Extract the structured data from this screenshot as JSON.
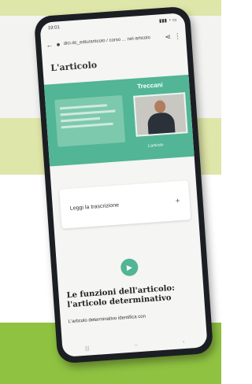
{
  "status_bar": {
    "time": "19:01",
    "indicators": "▮▮▮ ◔ ▭"
  },
  "browser": {
    "url": "dici.dc_edtu/articolo / corso ... nel-articolo",
    "share_icon": "share-icon",
    "menu_icon": "more-vert-icon"
  },
  "page": {
    "heading": "L'articolo",
    "banner": {
      "logo": "Treccani",
      "caption": "L'articolo"
    },
    "card_label": "Leggi la trascrizione",
    "card_plus": "+",
    "article_title": "Le funzioni dell'articolo: l'articolo determinativo",
    "article_subtitle": "L'articolo determinativo identifica con"
  }
}
